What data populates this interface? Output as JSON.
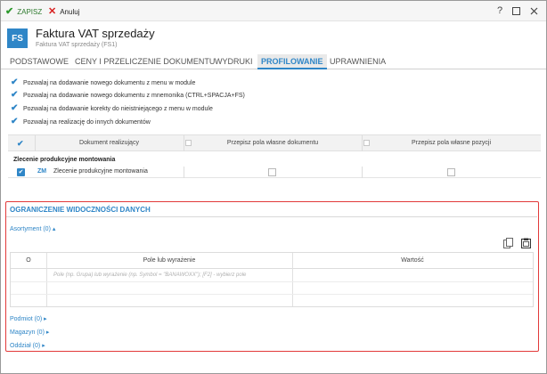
{
  "toolbar": {
    "save_label": "ZAPISZ",
    "cancel_label": "Anuluj"
  },
  "window_controls": {
    "help": "?"
  },
  "header": {
    "badge": "FS",
    "title": "Faktura VAT sprzedaży",
    "subtitle": "Faktura VAT sprzedaży (FS1)"
  },
  "tabs": [
    {
      "label": "PODSTAWOWE",
      "active": false
    },
    {
      "label": "CENY I PRZELICZENIE DOKUMENTU",
      "active": false
    },
    {
      "label": "WYDRUKI",
      "active": false
    },
    {
      "label": "PROFILOWANIE",
      "active": true
    },
    {
      "label": "UPRAWNIENIA",
      "active": false
    }
  ],
  "permissions": [
    {
      "label": "Pozwalaj na dodawanie nowego dokumentu z menu w module",
      "checked": true
    },
    {
      "label": "Pozwalaj na dodawanie nowego dokumentu z mnemonika (CTRL+SPACJA+FS)",
      "checked": true
    },
    {
      "label": "Pozwalaj na dodawanie korekty do nieistniejącego z menu w module",
      "checked": true
    },
    {
      "label": "Pozwalaj na realizację do innych dokumentów",
      "checked": true
    }
  ],
  "related_table": {
    "columns": [
      "Dokument realizujący",
      "Przepisz pola własne dokumentu",
      "Przepisz pola własne pozycji"
    ],
    "group": "Zlecenie produkcyjne montowania",
    "rows": [
      {
        "checked": true,
        "code": "ZM",
        "name": "Zlecenie produkcyjne montowania",
        "copy_doc_fields": false,
        "copy_item_fields": false
      }
    ]
  },
  "visibility": {
    "title": "OGRANICZENIE WIDOCZNOŚCI DANYCH",
    "assortment_label": "Asortyment (0)",
    "table": {
      "columns": [
        "O",
        "Pole lub wyrażenie",
        "Wartość"
      ],
      "placeholder": "Pole (np. Grupa) lub wyrażenie (np. Symbol = \"BANAWOXX\"); [F2] - wybierz pole"
    },
    "collapsed_sections": [
      "Podmiot (0)",
      "Magazyn (0)",
      "Oddział (0)"
    ]
  },
  "icons": {
    "save": "check-icon",
    "cancel": "x-icon",
    "help": "help-icon",
    "maximize": "maximize-icon",
    "close": "close-icon",
    "copy": "copy-icon",
    "paste": "clipboard-icon"
  },
  "colors": {
    "accent": "#2f86c7",
    "save_green": "#2e9a2e",
    "cancel_red": "#d82020",
    "highlight_border": "#e23a3a"
  }
}
